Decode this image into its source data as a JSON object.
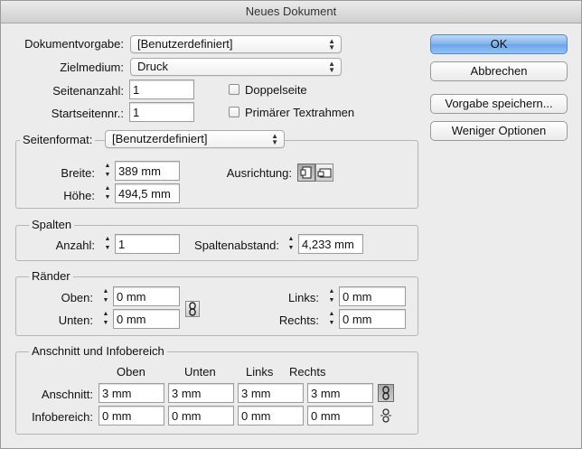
{
  "window": {
    "title": "Neues Dokument"
  },
  "preset": {
    "label": "Dokumentvorgabe:",
    "value": "[Benutzerdefiniert]"
  },
  "medium": {
    "label": "Zielmedium:",
    "value": "Druck"
  },
  "pages": {
    "label": "Seitenanzahl:",
    "value": "1"
  },
  "start_page": {
    "label": "Startseitennr.:",
    "value": "1"
  },
  "facing_pages": {
    "label": "Doppelseite",
    "checked": false
  },
  "primary_text_frame": {
    "label": "Primärer Textrahmen",
    "checked": false
  },
  "buttons": {
    "ok": "OK",
    "cancel": "Abbrechen",
    "save_preset": "Vorgabe speichern...",
    "fewer_options": "Weniger Optionen"
  },
  "page_size": {
    "label": "Seitenformat:",
    "value": "[Benutzerdefiniert]",
    "width_label": "Breite:",
    "width_value": "389 mm",
    "height_label": "Höhe:",
    "height_value": "494,5 mm",
    "orientation_label": "Ausrichtung:",
    "orientation_selected": "portrait"
  },
  "columns": {
    "title": "Spalten",
    "count_label": "Anzahl:",
    "count_value": "1",
    "gutter_label": "Spaltenabstand:",
    "gutter_value": "4,233 mm"
  },
  "margins": {
    "title": "Ränder",
    "top_label": "Oben:",
    "top_value": "0 mm",
    "bottom_label": "Unten:",
    "bottom_value": "0 mm",
    "left_label": "Links:",
    "left_value": "0 mm",
    "right_label": "Rechts:",
    "right_value": "0 mm"
  },
  "bleed_slug": {
    "title": "Anschnitt und Infobereich",
    "headers": [
      "Oben",
      "Unten",
      "Links",
      "Rechts"
    ],
    "rows": [
      {
        "label": "Anschnitt:",
        "values": [
          "3 mm",
          "3 mm",
          "3 mm",
          "3 mm"
        ]
      },
      {
        "label": "Infobereich:",
        "values": [
          "0 mm",
          "0 mm",
          "0 mm",
          "0 mm"
        ]
      }
    ]
  },
  "icons": {
    "chain": "chain-link-icon",
    "portrait": "portrait-orientation-icon",
    "landscape": "landscape-orientation-icon"
  }
}
